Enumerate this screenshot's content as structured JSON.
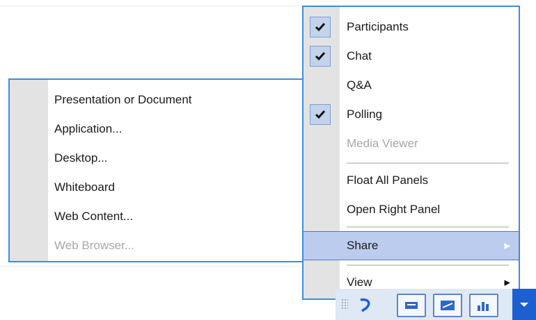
{
  "view_menu": {
    "items": [
      {
        "label": "Participants",
        "checked": true,
        "enabled": true
      },
      {
        "label": "Chat",
        "checked": true,
        "enabled": true
      },
      {
        "label": "Q&A",
        "checked": false,
        "enabled": true
      },
      {
        "label": "Polling",
        "checked": true,
        "enabled": true
      },
      {
        "label": "Media Viewer",
        "checked": false,
        "enabled": false
      },
      {
        "label": "Float All Panels",
        "enabled": true
      },
      {
        "label": "Open Right Panel",
        "enabled": true
      },
      {
        "label": "Share",
        "enabled": true,
        "submenu": true,
        "highlighted": true
      },
      {
        "label": "View",
        "enabled": true,
        "submenu": true
      }
    ]
  },
  "share_submenu": {
    "items": [
      {
        "label": "Presentation or Document",
        "enabled": true
      },
      {
        "label": "Application...",
        "enabled": true
      },
      {
        "label": "Desktop...",
        "enabled": true
      },
      {
        "label": "Whiteboard",
        "enabled": true
      },
      {
        "label": "Web Content...",
        "enabled": true
      },
      {
        "label": "Web Browser...",
        "enabled": false
      }
    ]
  },
  "toolbar": {
    "icons": [
      "grip-icon",
      "undo-arrow-icon",
      "panel-icon",
      "slides-icon",
      "bar-chart-icon",
      "dropdown-arrow-icon"
    ]
  },
  "colors": {
    "accent_border": "#3b8ed8",
    "highlight": "#bcccee",
    "check_bg": "#c3d3ec",
    "toolbar_dropdown": "#1c5fd0"
  }
}
